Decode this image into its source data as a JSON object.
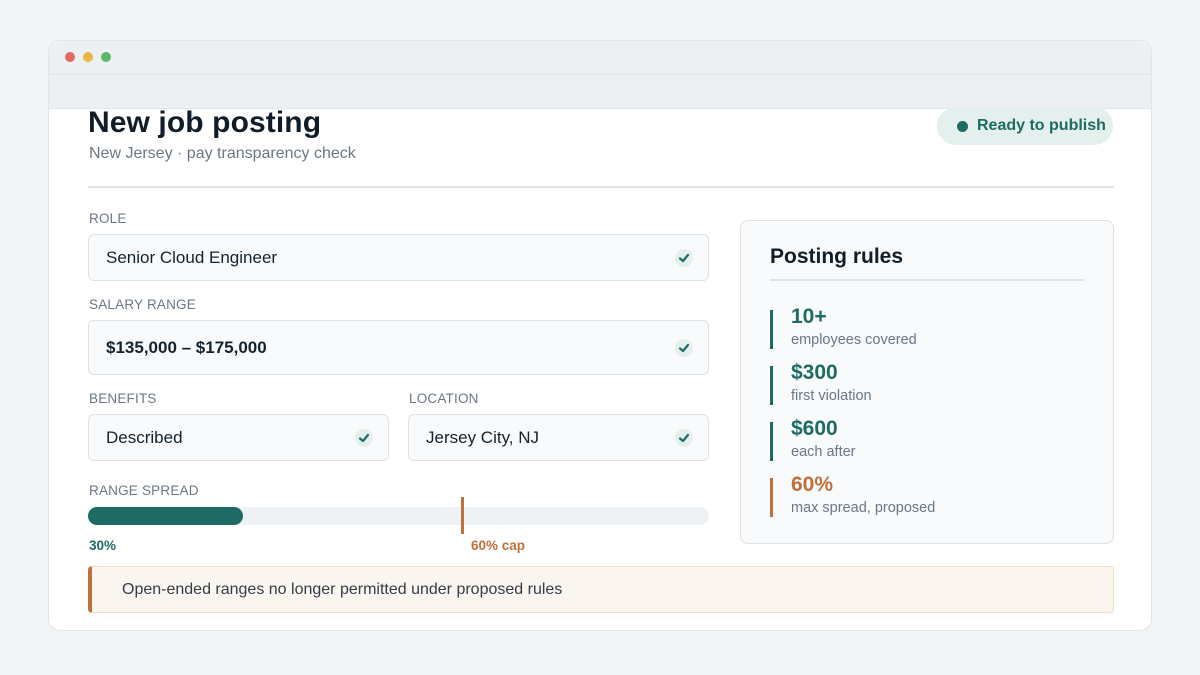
{
  "window": {
    "controls": [
      "close",
      "minimize",
      "maximize"
    ]
  },
  "header": {
    "title": "New job posting",
    "subtitle": "New Jersey · pay transparency check",
    "status": {
      "label": "Ready to publish",
      "color": "#1e6b63"
    }
  },
  "form": {
    "role": {
      "label": "ROLE",
      "value": "Senior Cloud Engineer",
      "valid": true
    },
    "salary": {
      "label": "SALARY RANGE",
      "value": "$135,000 – $175,000",
      "valid": true
    },
    "benefits": {
      "label": "BENEFITS",
      "value": "Described",
      "valid": true
    },
    "location": {
      "label": "LOCATION",
      "value": "Jersey City, NJ",
      "valid": true
    }
  },
  "range_spread": {
    "label": "RANGE SPREAD",
    "value_percent": 30,
    "value_label": "30%",
    "cap_percent": 60,
    "cap_label": "60% cap"
  },
  "notice": {
    "text": "Open-ended ranges no longer permitted under proposed rules",
    "accent": "#c0703b"
  },
  "rules": {
    "title": "Posting rules",
    "items": [
      {
        "value": "10+",
        "label": "employees covered",
        "tone": "ok"
      },
      {
        "value": "$300",
        "label": "first violation",
        "tone": "ok"
      },
      {
        "value": "$600",
        "label": "each after",
        "tone": "ok"
      },
      {
        "value": "60%",
        "label": "max spread, proposed",
        "tone": "warn"
      }
    ]
  },
  "colors": {
    "accent": "#1e6b63",
    "warning": "#c0703b",
    "background": "#f3f4f6"
  },
  "icons": {
    "field_valid": "check-icon",
    "status": "status-dot-icon"
  }
}
